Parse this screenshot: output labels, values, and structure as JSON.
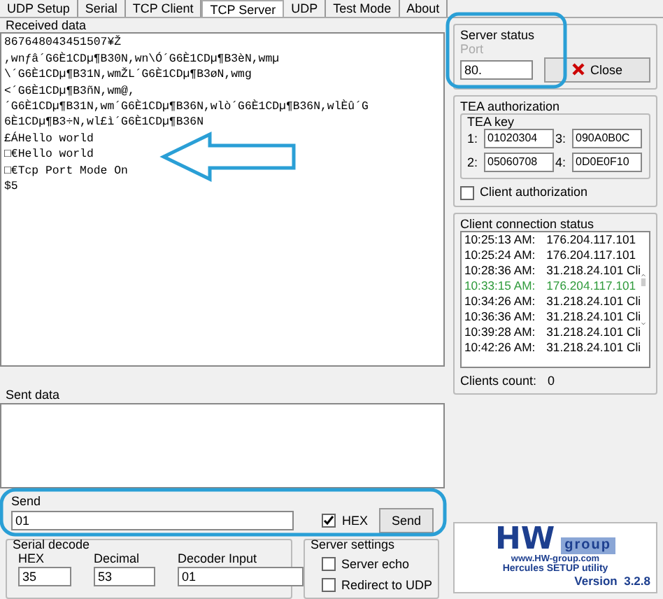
{
  "tabs": [
    {
      "label": "UDP Setup",
      "selected": false
    },
    {
      "label": "Serial",
      "selected": false
    },
    {
      "label": "TCP Client",
      "selected": false
    },
    {
      "label": "TCP Server",
      "selected": true
    },
    {
      "label": "UDP",
      "selected": false
    },
    {
      "label": "Test Mode",
      "selected": false
    },
    {
      "label": "About",
      "selected": false
    }
  ],
  "received": {
    "label": "Received data",
    "lines": [
      "867648043451507¥Ž",
      ",wnƒâ´G6È1CDµ¶B30N,wn\\Ó´G6È1CDµ¶B3èN,wmµ",
      "\\´G6È1CDµ¶B31N,wmŽL´G6È1CDµ¶B3øN,wmg",
      "<´G6È1CDµ¶B3ñN,wm@,",
      "´G6È1CDµ¶B31N,wm´G6È1CDµ¶B36N,wlò´G6È1CDµ¶B36N,wlÈû´G",
      "6È1CDµ¶B3÷N,wl£ì´G6È1CDµ¶B36N",
      "£ÁHello world",
      "□€Hello world",
      "□€Tcp Port Mode On",
      "$5"
    ]
  },
  "sent": {
    "label": "Sent data"
  },
  "send": {
    "label": "Send",
    "value": "01",
    "hex_label": "HEX",
    "hex_checked": true,
    "button": "Send"
  },
  "serial_decode": {
    "label": "Serial decode",
    "fields": [
      {
        "label": "HEX",
        "value": "35"
      },
      {
        "label": "Decimal",
        "value": "53"
      },
      {
        "label": "Decoder Input",
        "value": "01"
      }
    ]
  },
  "server_settings": {
    "label": "Server settings",
    "options": [
      {
        "label": "Server echo",
        "checked": false
      },
      {
        "label": "Redirect to UDP",
        "checked": false
      }
    ]
  },
  "server_status": {
    "label": "Server status",
    "port_label": "Port",
    "port": "80.",
    "button": "Close"
  },
  "tea": {
    "label": "TEA authorization",
    "key_label": "TEA key",
    "keys": [
      {
        "index": "1:",
        "value": "01020304"
      },
      {
        "index": "3:",
        "value": "090A0B0C"
      },
      {
        "index": "2:",
        "value": "05060708"
      },
      {
        "index": "4:",
        "value": "0D0E0F10"
      }
    ],
    "client_auth_label": "Client authorization",
    "client_auth_checked": false
  },
  "clients": {
    "label": "Client connection status",
    "rows": [
      {
        "time": "10:25:13 AM:",
        "address": "176.204.117.101",
        "color": "#000000"
      },
      {
        "time": "10:25:24 AM:",
        "address": "176.204.117.101",
        "color": "#000000"
      },
      {
        "time": "10:28:36 AM:",
        "address": "31.218.24.101 Cli",
        "color": "#000000"
      },
      {
        "time": "10:33:15 AM:",
        "address": "176.204.117.101",
        "color": "#2e9a3a"
      },
      {
        "time": "10:34:26 AM:",
        "address": "31.218.24.101 Cli",
        "color": "#000000"
      },
      {
        "time": "10:36:36 AM:",
        "address": "31.218.24.101 Cli",
        "color": "#000000"
      },
      {
        "time": "10:39:28 AM:",
        "address": "31.218.24.101 Cli",
        "color": "#000000"
      },
      {
        "time": "10:42:26 AM:",
        "address": "31.218.24.101 Cli",
        "color": "#000000"
      }
    ],
    "count_label": "Clients count:",
    "count": "0"
  },
  "logo": {
    "brand_1": "HW",
    "brand_2": "group",
    "url": "www.HW-group.com",
    "product": "Hercules SETUP utility",
    "version": "Version  3.2.8"
  }
}
